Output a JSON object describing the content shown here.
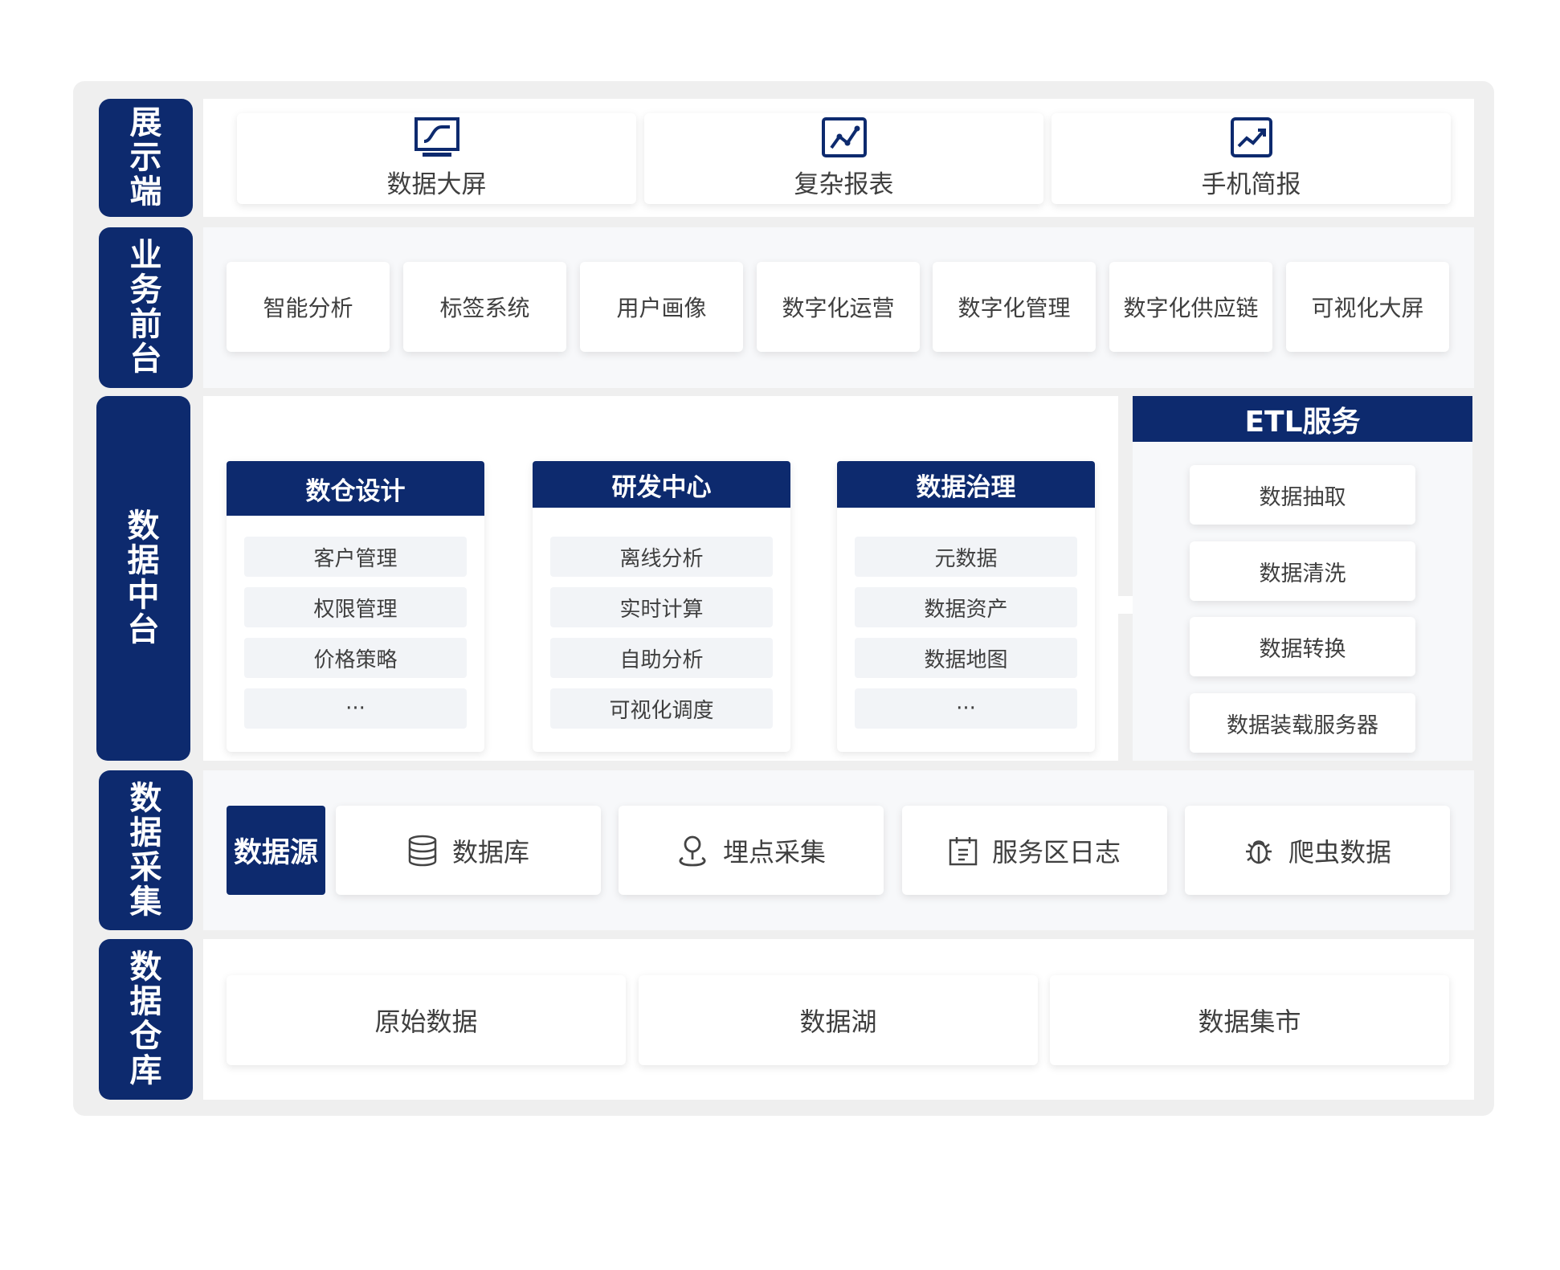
{
  "layers": {
    "display": "展示端",
    "business": "业务前台",
    "middle": "数据中台",
    "collect": "数据采集",
    "warehouse": "数据仓库"
  },
  "display_items": [
    {
      "label": "数据大屏",
      "icon": "monitor-chart-icon"
    },
    {
      "label": "复杂报表",
      "icon": "line-chart-icon"
    },
    {
      "label": "手机简报",
      "icon": "trend-up-icon"
    }
  ],
  "business_items": [
    "智能分析",
    "标签系统",
    "用户画像",
    "数字化运营",
    "数字化管理",
    "数字化供应链",
    "可视化大屏"
  ],
  "middle_modules": [
    {
      "title": "数仓设计",
      "items": [
        "客户管理",
        "权限管理",
        "价格策略",
        "···"
      ]
    },
    {
      "title": "研发中心",
      "items": [
        "离线分析",
        "实时计算",
        "自助分析",
        "可视化调度"
      ]
    },
    {
      "title": "数据治理",
      "items": [
        "元数据",
        "数据资产",
        "数据地图",
        "···"
      ]
    }
  ],
  "etl": {
    "title": "ETL服务",
    "items": [
      "数据抽取",
      "数据清洗",
      "数据转换",
      "数据装载服务器"
    ]
  },
  "collect": {
    "source_label": "数据源",
    "items": [
      {
        "label": "数据库",
        "icon": "database-icon"
      },
      {
        "label": "埋点采集",
        "icon": "location-pin-icon"
      },
      {
        "label": "服务区日志",
        "icon": "calendar-log-icon"
      },
      {
        "label": "爬虫数据",
        "icon": "bug-icon"
      }
    ]
  },
  "warehouse_items": [
    "原始数据",
    "数据湖",
    "数据集市"
  ],
  "colors": {
    "navy": "#0d2a6e",
    "frame": "#efefef",
    "panel": "#f7f8fa",
    "pill": "#f2f4f7"
  }
}
